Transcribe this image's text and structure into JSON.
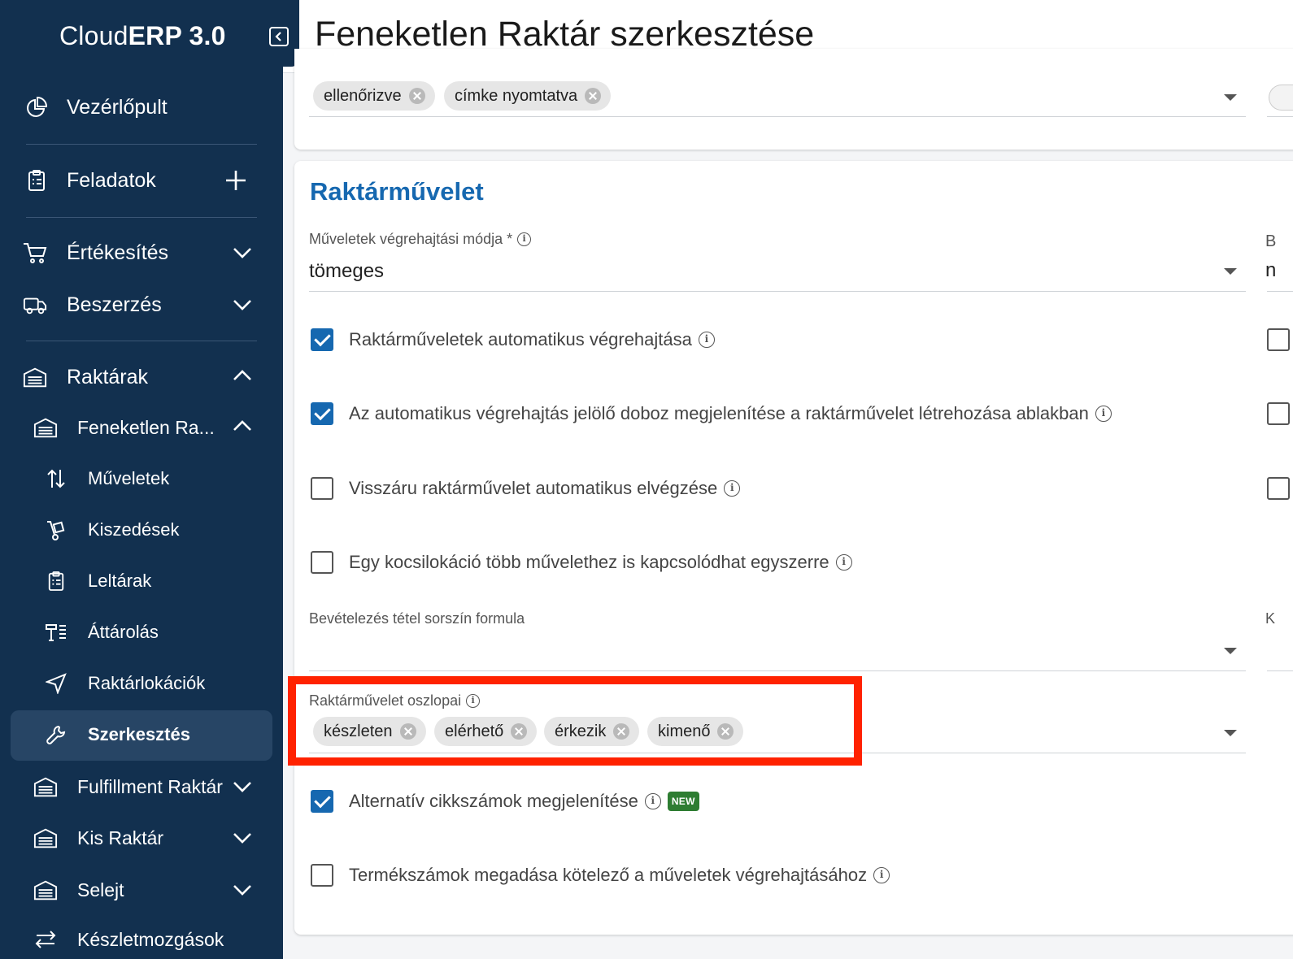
{
  "app": {
    "brand_light": "Cloud",
    "brand_bold": "ERP 3.0"
  },
  "header": {
    "title": "Feneketlen Raktár szerkesztése"
  },
  "sidebar": {
    "items": [
      {
        "label": "Vezérlőpult",
        "icon": "pie-chart-icon"
      },
      {
        "label": "Feladatok",
        "icon": "clipboard-icon"
      },
      {
        "label": "Értékesítés",
        "icon": "cart-icon"
      },
      {
        "label": "Beszerzés",
        "icon": "truck-icon"
      },
      {
        "label": "Raktárak",
        "icon": "warehouse-icon"
      },
      {
        "label": "Feneketlen Ra...",
        "icon": "warehouse-icon"
      },
      {
        "label": "Műveletek",
        "icon": "arrows-updown-icon"
      },
      {
        "label": "Kiszedések",
        "icon": "hand-truck-icon"
      },
      {
        "label": "Leltárak",
        "icon": "clipboard-icon"
      },
      {
        "label": "Áttárolás",
        "icon": "transfer-icon"
      },
      {
        "label": "Raktárlokációk",
        "icon": "location-arrow-icon"
      },
      {
        "label": "Szerkesztés",
        "icon": "wrench-icon"
      },
      {
        "label": "Fulfillment Raktár",
        "icon": "warehouse-icon"
      },
      {
        "label": "Kis Raktár",
        "icon": "warehouse-icon"
      },
      {
        "label": "Selejt",
        "icon": "warehouse-icon"
      },
      {
        "label": "Készletmozgások",
        "icon": "arrows-icon"
      }
    ]
  },
  "top_card": {
    "chips": [
      "ellenőrizve",
      "címke nyomtatva"
    ]
  },
  "section": {
    "title": "Raktárművelet",
    "mode_label": "Műveletek végrehajtási módja *",
    "mode_value": "tömeges",
    "checkboxes": [
      {
        "label": "Raktárműveletek automatikus végrehajtása",
        "checked": true
      },
      {
        "label": "Az automatikus végrehajtás jelölő doboz megjelenítése a raktárművelet létrehozása ablakban",
        "checked": true
      },
      {
        "label": "Visszáru raktárművelet automatikus elvégzése",
        "checked": false
      },
      {
        "label": "Egy kocsilokáció több művelethez is kapcsolódhat egyszerre",
        "checked": false
      }
    ],
    "formula_label": "Bevételezés tétel sorszín formula",
    "columns_label": "Raktárművelet oszlopai",
    "columns_chips": [
      "készleten",
      "elérhető",
      "érkezik",
      "kimenő"
    ],
    "alt_label": "Alternatív cikkszámok megjelenítése",
    "alt_checked": true,
    "new_badge": "NEW",
    "product_label": "Termékszámok megadása kötelező a műveletek végrehajtásához",
    "product_checked": false
  },
  "right_edge": {
    "b": "B",
    "n": "n",
    "k": "K"
  },
  "colors": {
    "sidebar_bg": "#12304f",
    "accent": "#1668b0",
    "highlight": "#ff2200",
    "new_badge": "#2e7d32"
  }
}
